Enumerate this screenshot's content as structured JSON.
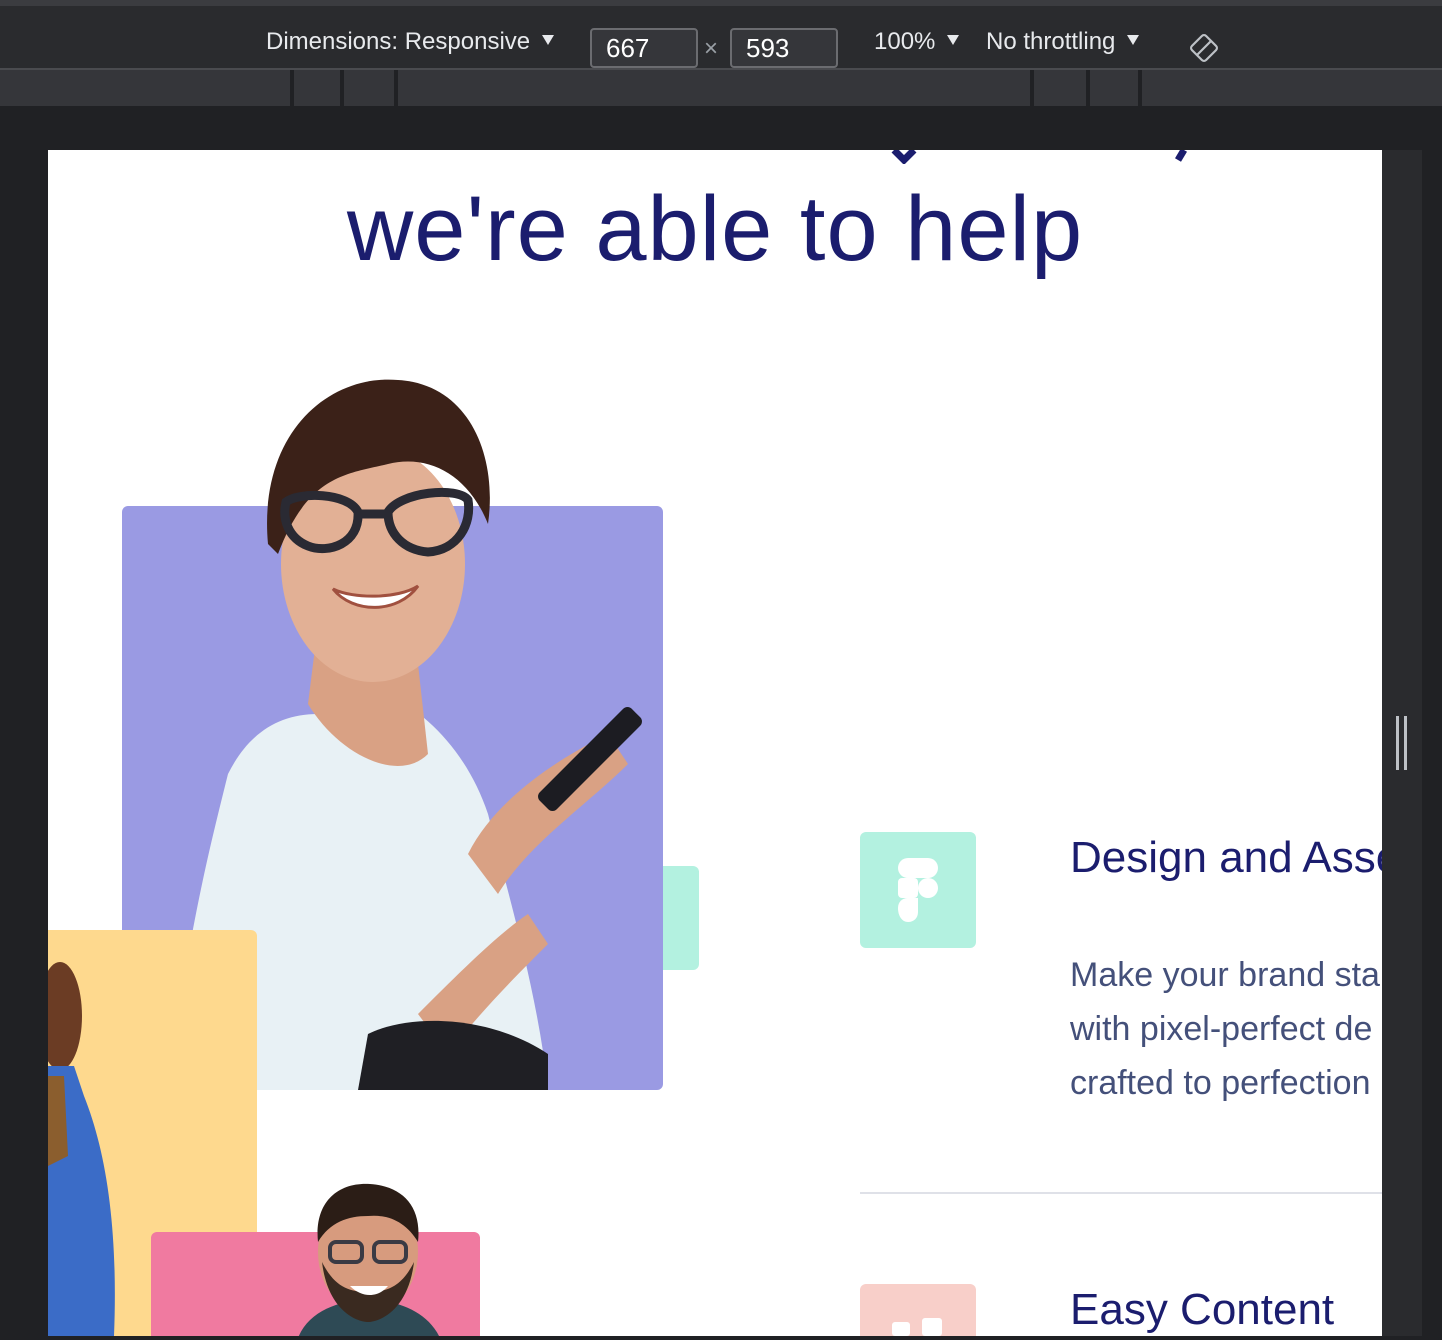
{
  "toolbar": {
    "dimensions_label": "Dimensions: Responsive",
    "width_value": "667",
    "times": "×",
    "height_value": "593",
    "zoom_label": "100%",
    "throttling_label": "No throttling",
    "rotate_icon": "rotate-icon"
  },
  "page": {
    "headline": "we're able to help",
    "features": [
      {
        "icon": "figma-icon",
        "icon_color": "#b3f1e0",
        "title": "Design and Asse",
        "desc_lines": [
          "Make your brand sta",
          "with pixel-perfect de",
          "crafted to perfection"
        ]
      },
      {
        "icon": "content-icon",
        "icon_color": "#f8cfc9",
        "title": "Easy Content"
      }
    ]
  },
  "colors": {
    "headline": "#1b1d6e",
    "card_purple": "#9a9ae3",
    "card_mint": "#b3f1e0",
    "card_yellow": "#fed98e",
    "card_pink": "#f07aa0"
  }
}
